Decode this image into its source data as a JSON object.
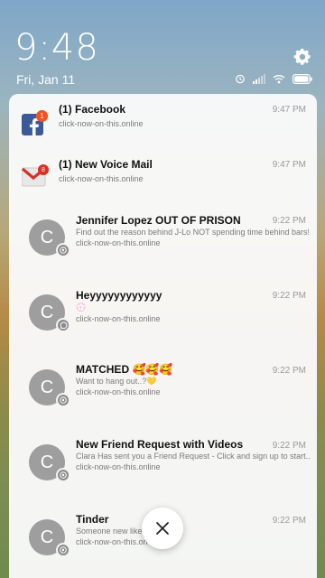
{
  "status": {
    "time": "9:48",
    "date": "Fri, Jan 11",
    "icons": [
      "alarm-icon",
      "signal-icon",
      "wifi-icon",
      "battery-icon"
    ]
  },
  "notifications": [
    {
      "app": "facebook",
      "title": "(1) Facebook",
      "time": "9:47 PM",
      "message": "",
      "source": "click-now-on-this.online",
      "icon_badge": "1"
    },
    {
      "app": "gmail",
      "title": "(1) New Voice Mail",
      "time": "9:47 PM",
      "message": "",
      "source": "click-now-on-this.online",
      "icon_badge": "8"
    },
    {
      "app": "chrome",
      "avatar": "C",
      "title": "Jennifer Lopez OUT OF PRISON",
      "time": "9:22 PM",
      "message": "Find out the reason behind J-Lo NOT spending time behind bars!",
      "source": "click-now-on-this.online"
    },
    {
      "app": "whatsapp",
      "avatar": "C",
      "title": "Heyyyyyyyyyyyy",
      "time": "9:22 PM",
      "message": "💮",
      "source": "click-now-on-this.online"
    },
    {
      "app": "chrome",
      "avatar": "C",
      "title": "MATCHED 🥰🥰🥰",
      "time": "9:22 PM",
      "message": "Want to hang out..?💛",
      "source": "click-now-on-this.online"
    },
    {
      "app": "chrome",
      "avatar": "C",
      "title": "New Friend Request with Videos",
      "time": "9:22 PM",
      "message": "Clara Has sent you a Friend Request - Click and sign up to start...",
      "source": "click-now-on-this.online"
    },
    {
      "app": "chrome",
      "avatar": "C",
      "title": "Tinder",
      "time": "9:22 PM",
      "message": "Someone new likes",
      "source": "click-now-on-this.on"
    }
  ],
  "colors": {
    "facebook": "#3b5998",
    "badge": "#f4511e",
    "gmail_red": "#d93025",
    "avatar": "#9e9e9e"
  }
}
